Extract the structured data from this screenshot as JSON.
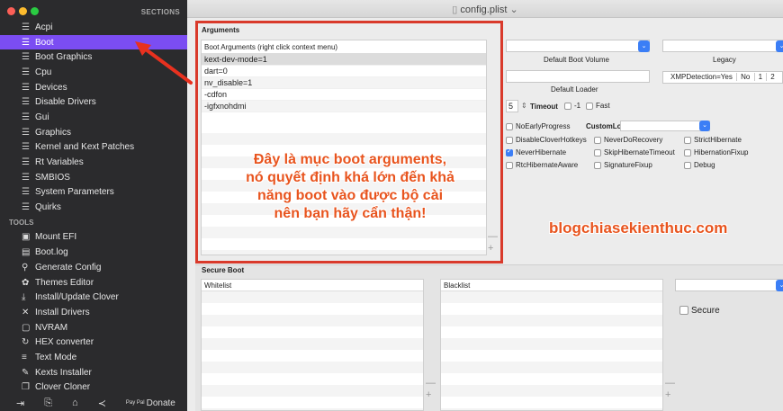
{
  "window": {
    "title": "config.plist"
  },
  "sidebar": {
    "sections_label": "SECTIONS",
    "items": [
      {
        "label": "Acpi"
      },
      {
        "label": "Boot",
        "active": true
      },
      {
        "label": "Boot Graphics"
      },
      {
        "label": "Cpu"
      },
      {
        "label": "Devices"
      },
      {
        "label": "Disable Drivers"
      },
      {
        "label": "Gui"
      },
      {
        "label": "Graphics"
      },
      {
        "label": "Kernel and Kext Patches"
      },
      {
        "label": "Rt Variables"
      },
      {
        "label": "SMBIOS"
      },
      {
        "label": "System Parameters"
      },
      {
        "label": "Quirks"
      }
    ],
    "tools_label": "TOOLS",
    "tools": [
      {
        "label": "Mount EFI",
        "icon": "disk-icon"
      },
      {
        "label": "Boot.log",
        "icon": "log-icon"
      },
      {
        "label": "Generate Config",
        "icon": "config-icon"
      },
      {
        "label": "Themes Editor",
        "icon": "palette-icon"
      },
      {
        "label": "Install/Update Clover",
        "icon": "install-icon"
      },
      {
        "label": "Install Drivers",
        "icon": "tools-icon"
      },
      {
        "label": "NVRAM",
        "icon": "chip-icon"
      },
      {
        "label": "HEX converter",
        "icon": "refresh-icon"
      },
      {
        "label": "Text Mode",
        "icon": "text-icon"
      },
      {
        "label": "Kexts Installer",
        "icon": "wrench-icon"
      },
      {
        "label": "Clover Cloner",
        "icon": "clone-icon"
      }
    ],
    "bottom": {
      "donate_small": "Pay Pal",
      "donate": "Donate"
    }
  },
  "arguments": {
    "section_label": "Arguments",
    "list_header": "Boot Arguments (right click context menu)",
    "items": [
      "kext-dev-mode=1",
      "dart=0",
      "nv_disable=1",
      "-cdfon",
      "-igfxnohdmi"
    ]
  },
  "boot": {
    "default_boot_volume_label": "Default Boot Volume",
    "legacy_label": "Legacy",
    "default_loader_label": "Default Loader",
    "legacy_values": [
      "XMPDetection=Yes",
      "No",
      "1",
      "2"
    ],
    "timeout_value": "5",
    "timeout_label": "Timeout",
    "minus_one_label": "-1",
    "fast_label": "Fast",
    "no_early_progress": "NoEarlyProgress",
    "custom_logo": "CustomLogo",
    "checkboxes": [
      {
        "label": "DisableCloverHotkeys",
        "checked": false
      },
      {
        "label": "NeverDoRecovery",
        "checked": false
      },
      {
        "label": "StrictHibernate",
        "checked": false
      },
      {
        "label": "NeverHibernate",
        "checked": true
      },
      {
        "label": "SkipHibernateTimeout",
        "checked": false
      },
      {
        "label": "HibernationFixup",
        "checked": false
      },
      {
        "label": "RtcHibernateAware",
        "checked": false
      },
      {
        "label": "SignatureFixup",
        "checked": false
      },
      {
        "label": "Debug",
        "checked": false
      }
    ]
  },
  "secure_boot": {
    "section_label": "Secure Boot",
    "whitelist_label": "Whitelist",
    "blacklist_label": "Blacklist",
    "secure_label": "Secure"
  },
  "annotation": {
    "lines": [
      "Đây là mục boot arguments,",
      "nó quyết định khá lớn đến khả",
      "năng boot vào được bộ cài",
      "nên bạn hãy cẩn thận!"
    ],
    "watermark": "blogchiasekienthuc.com"
  },
  "colors": {
    "accent": "#7b4df2",
    "annotation": "#e8541e",
    "highlight_border": "#d93a2b",
    "checkbox_on": "#3b7ef6"
  }
}
